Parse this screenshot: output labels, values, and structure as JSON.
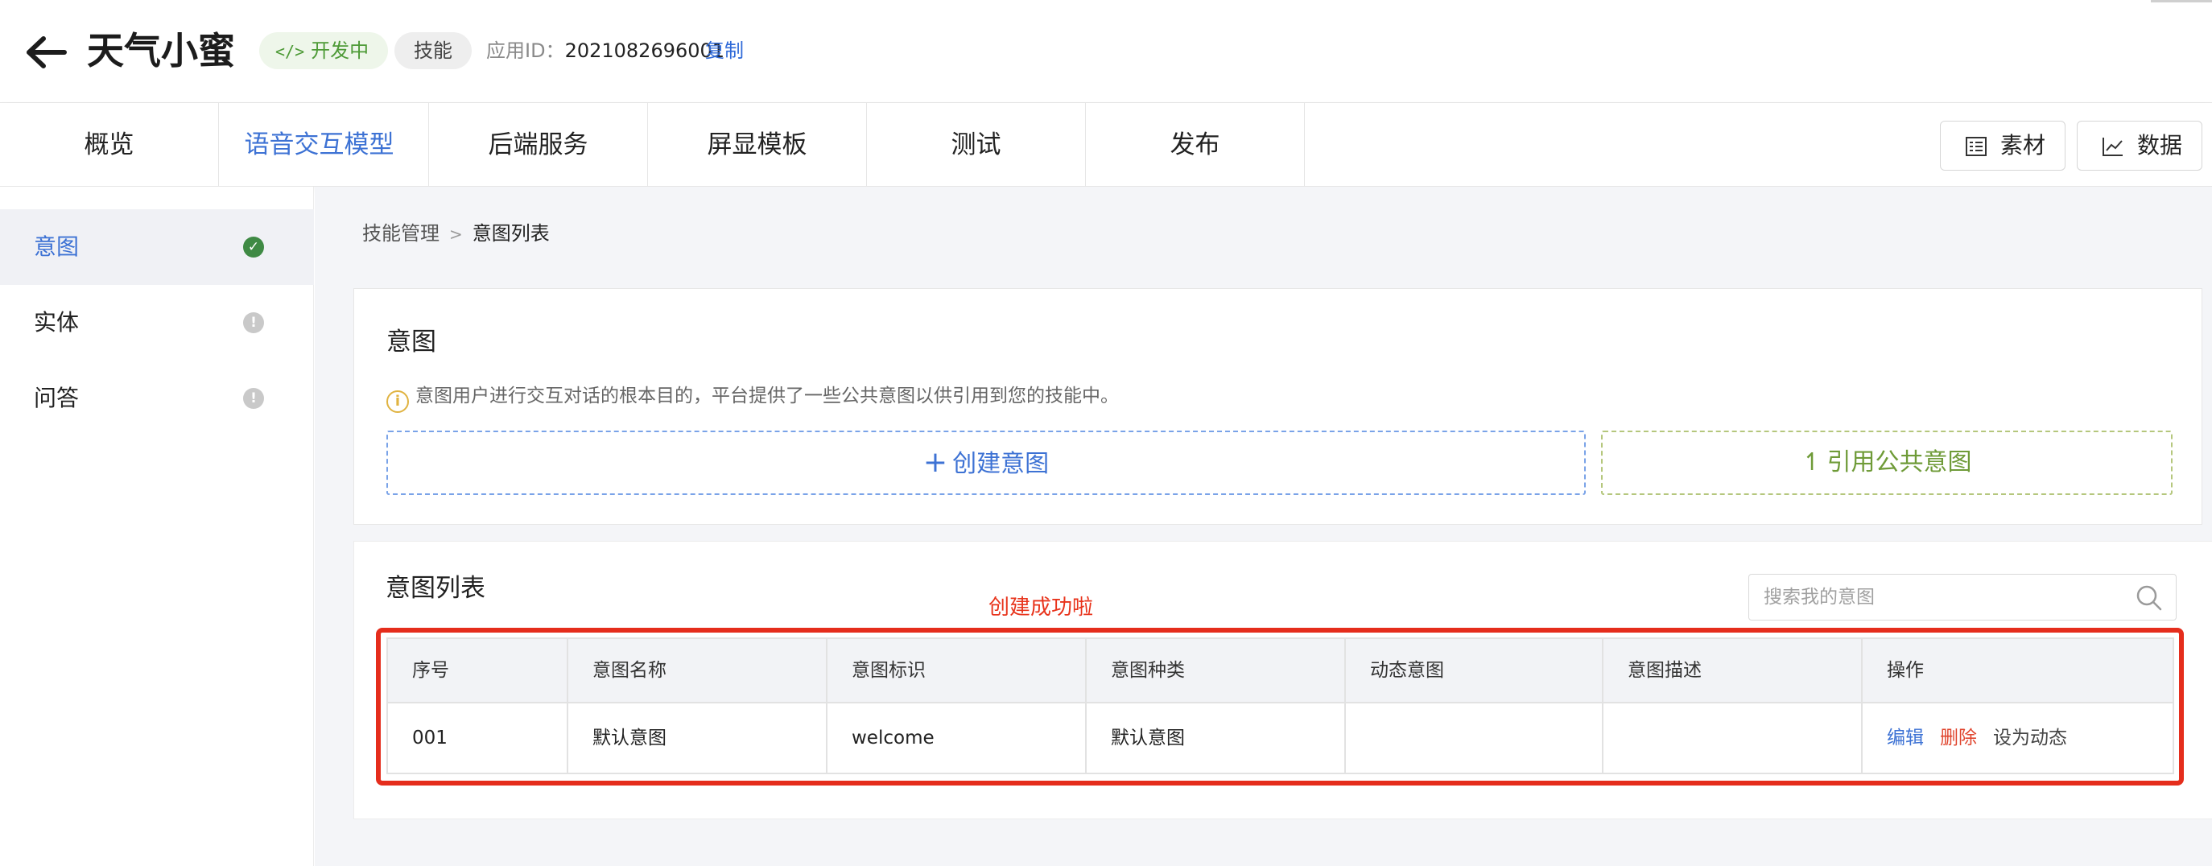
{
  "app": {
    "title": "天气小蜜",
    "status_badge": "开发中",
    "type_badge": "技能",
    "app_id_label": "应用ID：",
    "app_id_value": "2021082696001",
    "copy_label": "复制"
  },
  "tabs": [
    {
      "label": "概览",
      "active": false
    },
    {
      "label": "语音交互模型",
      "active": true
    },
    {
      "label": "后端服务",
      "active": false
    },
    {
      "label": "屏显模板",
      "active": false
    },
    {
      "label": "测试",
      "active": false
    },
    {
      "label": "发布",
      "active": false
    }
  ],
  "toolbar": {
    "material_label": "素材",
    "data_label": "数据"
  },
  "sidebar": {
    "items": [
      {
        "label": "意图",
        "status": "complete",
        "active": true
      },
      {
        "label": "实体",
        "status": "info",
        "active": false
      },
      {
        "label": "问答",
        "status": "info",
        "active": false
      }
    ]
  },
  "breadcrumb": [
    "技能管理",
    "意图列表"
  ],
  "intent_card": {
    "title": "意图",
    "info": "意图用户进行交互对话的根本目的，平台提供了一些公共意图以供引用到您的技能中。",
    "create_label": "创建意图",
    "reference_label": "引用公共意图"
  },
  "intent_list": {
    "title": "意图列表",
    "search_placeholder": "搜索我的意图",
    "annotation": "创建成功啦",
    "columns": [
      "序号",
      "意图名称",
      "意图标识",
      "意图种类",
      "动态意图",
      "意图描述",
      "操作"
    ],
    "rows": [
      {
        "index": "001",
        "name": "默认意图",
        "identifier": "welcome",
        "kind": "默认意图",
        "dynamic": "",
        "description": "",
        "actions": {
          "edit": "编辑",
          "delete": "删除",
          "set_dynamic": "设为动态"
        }
      }
    ]
  },
  "colors": {
    "accent": "#3d72d4",
    "success": "#3f8a44",
    "danger": "#e0462f",
    "annotation_red": "#e52d1c",
    "reference_green": "#6f9b38"
  }
}
